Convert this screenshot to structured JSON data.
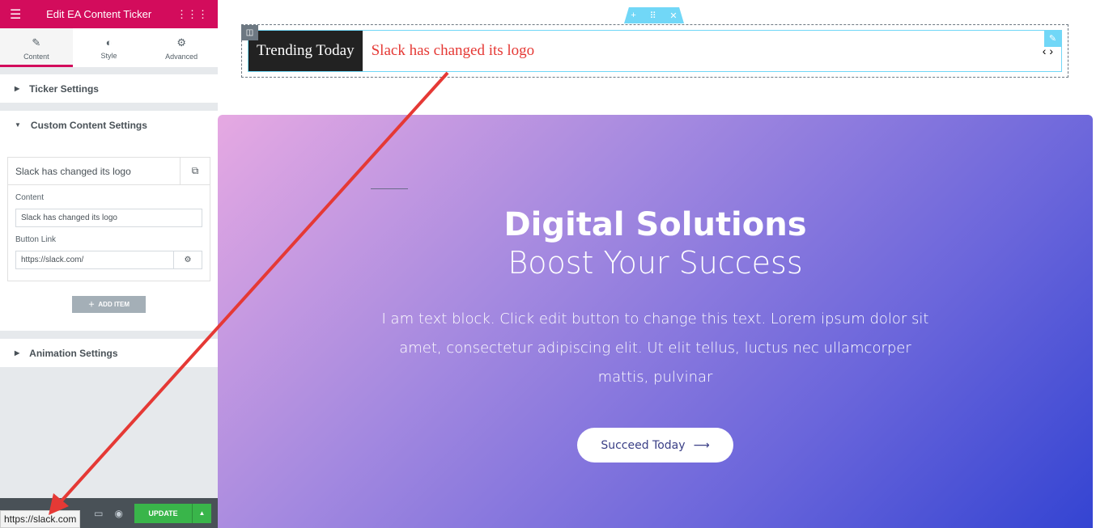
{
  "panel": {
    "title": "Edit EA Content Ticker",
    "tabs": [
      {
        "label": "Content",
        "icon": "pencil-icon"
      },
      {
        "label": "Style",
        "icon": "contrast-icon"
      },
      {
        "label": "Advanced",
        "icon": "gear-icon"
      }
    ],
    "sections": {
      "ticker": "Ticker Settings",
      "custom": "Custom Content Settings",
      "animation": "Animation Settings"
    },
    "item": {
      "title": "Slack has changed its logo",
      "content_label": "Content",
      "content_value": "Slack has changed its logo",
      "link_label": "Button Link",
      "link_value": "https://slack.com/"
    },
    "add_item": "ADD ITEM",
    "update": "UPDATE",
    "status_url": "https://slack.com"
  },
  "canvas": {
    "ticker_label": "Trending Today",
    "ticker_message": "Slack has changed its logo",
    "hero": {
      "title": "Digital Solutions",
      "subtitle": "Boost Your Success",
      "text": "I am text block. Click edit button to change this text. Lorem ipsum dolor sit amet, consectetur adipiscing elit. Ut elit tellus, luctus nec ullamcorper mattis, pulvinar",
      "button": "Succeed Today"
    }
  },
  "colors": {
    "brand": "#d30c5c",
    "update": "#39b54a",
    "ticker_text": "#e53935",
    "editor_accent": "#71d7f7"
  }
}
